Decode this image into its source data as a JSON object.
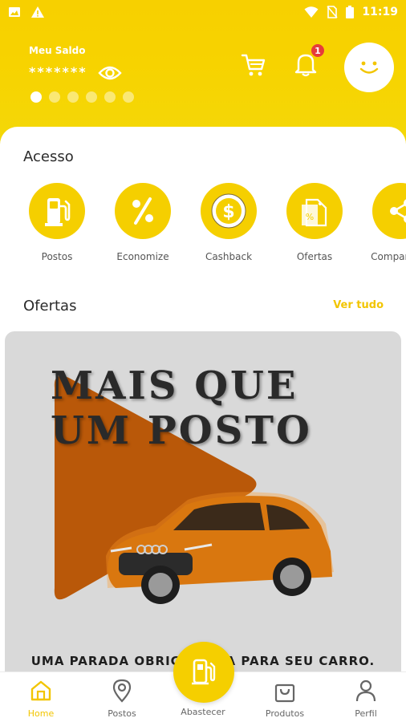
{
  "status_bar": {
    "time": "11:19"
  },
  "header": {
    "balance_label": "Meu Saldo",
    "balance_value": "*******",
    "notification_count": "1"
  },
  "access": {
    "title": "Acesso",
    "items": [
      {
        "label": "Postos",
        "icon": "fuel-pump-icon"
      },
      {
        "label": "Economize",
        "icon": "percent-icon"
      },
      {
        "label": "Cashback",
        "icon": "dollar-coin-icon"
      },
      {
        "label": "Ofertas",
        "icon": "price-tag-icon"
      },
      {
        "label": "Compartilhe",
        "icon": "share-icon"
      }
    ]
  },
  "offers": {
    "title": "Ofertas",
    "see_all": "Ver tudo",
    "banner": {
      "headline_line1": "MAIS QUE",
      "headline_line2": "UM POSTO",
      "tagline": "UMA PARADA OBRIGATÓRIA PARA SEU CARRO."
    }
  },
  "bottom_nav": {
    "items": [
      {
        "label": "Home",
        "icon": "home-icon",
        "active": true
      },
      {
        "label": "Postos",
        "icon": "location-pin-icon"
      },
      {
        "label": "Abastecer",
        "icon": "fuel-pump-icon"
      },
      {
        "label": "Produtos",
        "icon": "shopping-bag-icon"
      },
      {
        "label": "Perfil",
        "icon": "user-icon"
      }
    ]
  },
  "colors": {
    "brand_yellow": "#f5cf00",
    "accent_text": "#f2c500",
    "badge_red": "#e63b3b"
  }
}
